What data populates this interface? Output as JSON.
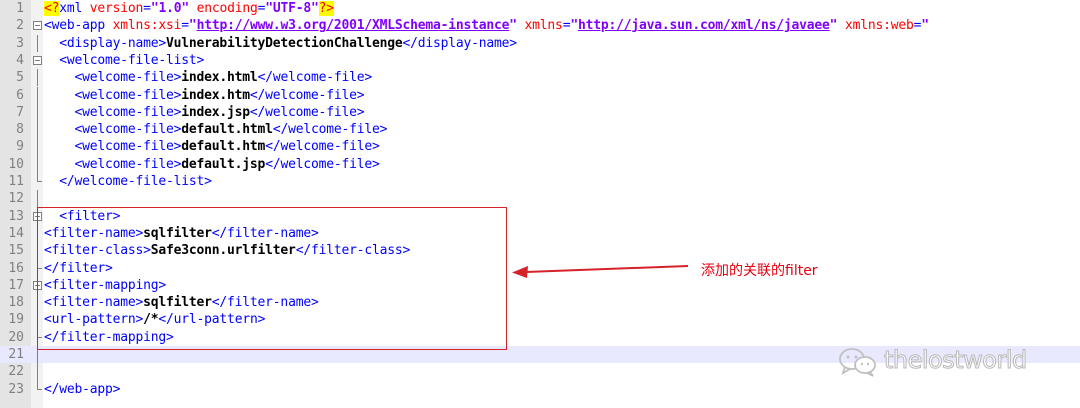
{
  "editor": {
    "lines": [
      {
        "n": "1",
        "fold": "none",
        "parts": [
          [
            "pi",
            "<?"
          ],
          [
            "tag",
            "xml "
          ],
          [
            "attr",
            "version"
          ],
          [
            "tag",
            "="
          ],
          [
            "val",
            "\"1.0\""
          ],
          [
            "tag",
            " "
          ],
          [
            "attr",
            "encoding"
          ],
          [
            "tag",
            "="
          ],
          [
            "val",
            "\"UTF-8\""
          ],
          [
            "pi",
            "?>"
          ]
        ]
      },
      {
        "n": "2",
        "fold": "box",
        "parts": [
          [
            "tag",
            "<web-app "
          ],
          [
            "attr",
            "xmlns:xsi"
          ],
          [
            "tag",
            "="
          ],
          [
            "val",
            "\""
          ],
          [
            "url",
            "http://www.w3.org/2001/XMLSchema-instance"
          ],
          [
            "val",
            "\""
          ],
          [
            "tag",
            " "
          ],
          [
            "attr",
            "xmlns"
          ],
          [
            "tag",
            "="
          ],
          [
            "val",
            "\""
          ],
          [
            "url",
            "http://java.sun.com/xml/ns/javaee"
          ],
          [
            "val",
            "\""
          ],
          [
            "tag",
            " "
          ],
          [
            "attr",
            "xmlns:web"
          ],
          [
            "tag",
            "="
          ],
          [
            "val",
            "\""
          ]
        ]
      },
      {
        "n": "3",
        "fold": "vline",
        "parts": [
          [
            "tag",
            "  <display-name>"
          ],
          [
            "txt",
            "VulnerabilityDetectionChallenge"
          ],
          [
            "tag",
            "</display-name>"
          ]
        ]
      },
      {
        "n": "4",
        "fold": "box",
        "parts": [
          [
            "tag",
            "  <welcome-file-list>"
          ]
        ]
      },
      {
        "n": "5",
        "fold": "vline",
        "parts": [
          [
            "tag",
            "    <welcome-file>"
          ],
          [
            "txt",
            "index.html"
          ],
          [
            "tag",
            "</welcome-file>"
          ]
        ]
      },
      {
        "n": "6",
        "fold": "vline",
        "parts": [
          [
            "tag",
            "    <welcome-file>"
          ],
          [
            "txt",
            "index.htm"
          ],
          [
            "tag",
            "</welcome-file>"
          ]
        ]
      },
      {
        "n": "7",
        "fold": "vline",
        "parts": [
          [
            "tag",
            "    <welcome-file>"
          ],
          [
            "txt",
            "index.jsp"
          ],
          [
            "tag",
            "</welcome-file>"
          ]
        ]
      },
      {
        "n": "8",
        "fold": "vline",
        "parts": [
          [
            "tag",
            "    <welcome-file>"
          ],
          [
            "txt",
            "default.html"
          ],
          [
            "tag",
            "</welcome-file>"
          ]
        ]
      },
      {
        "n": "9",
        "fold": "vline",
        "parts": [
          [
            "tag",
            "    <welcome-file>"
          ],
          [
            "txt",
            "default.htm"
          ],
          [
            "tag",
            "</welcome-file>"
          ]
        ]
      },
      {
        "n": "10",
        "fold": "vline",
        "parts": [
          [
            "tag",
            "    <welcome-file>"
          ],
          [
            "txt",
            "default.jsp"
          ],
          [
            "tag",
            "</welcome-file>"
          ]
        ]
      },
      {
        "n": "11",
        "fold": "end",
        "parts": [
          [
            "tag",
            "  </welcome-file-list>"
          ]
        ]
      },
      {
        "n": "12",
        "fold": "vline",
        "parts": []
      },
      {
        "n": "13",
        "fold": "box",
        "parts": [
          [
            "tag",
            "  <filter>"
          ]
        ]
      },
      {
        "n": "14",
        "fold": "vline",
        "parts": [
          [
            "tag",
            "<filter-name>"
          ],
          [
            "txt",
            "sqlfilter"
          ],
          [
            "tag",
            "</filter-name>"
          ]
        ]
      },
      {
        "n": "15",
        "fold": "vline",
        "parts": [
          [
            "tag",
            "<filter-class>"
          ],
          [
            "txt",
            "Safe3conn.urlfilter"
          ],
          [
            "tag",
            "</filter-class>"
          ]
        ]
      },
      {
        "n": "16",
        "fold": "end",
        "parts": [
          [
            "tag",
            "</filter>"
          ]
        ]
      },
      {
        "n": "17",
        "fold": "box",
        "parts": [
          [
            "tag",
            "<filter-mapping>"
          ]
        ]
      },
      {
        "n": "18",
        "fold": "vline",
        "parts": [
          [
            "tag",
            "<filter-name>"
          ],
          [
            "txt",
            "sqlfilter"
          ],
          [
            "tag",
            "</filter-name>"
          ]
        ]
      },
      {
        "n": "19",
        "fold": "vline",
        "parts": [
          [
            "tag",
            "<url-pattern>"
          ],
          [
            "txt",
            "/*"
          ],
          [
            "tag",
            "</url-pattern>"
          ]
        ]
      },
      {
        "n": "20",
        "fold": "end",
        "parts": [
          [
            "tag",
            "</filter-mapping>"
          ]
        ]
      },
      {
        "n": "21",
        "fold": "vline",
        "parts": [],
        "current": true
      },
      {
        "n": "22",
        "fold": "vline",
        "parts": []
      },
      {
        "n": "23",
        "fold": "end",
        "parts": [
          [
            "tag",
            "</web-app>"
          ]
        ]
      }
    ]
  },
  "annotation": {
    "note": "添加的关联的filter",
    "color": "#e60012"
  },
  "watermark": {
    "text": "thelostworld",
    "icon": "wechat-icon"
  },
  "colors": {
    "tag": "#0000ff",
    "attribute": "#ff0000",
    "value": "#8000ff",
    "text": "#000000",
    "gutter": "#e4e4e4",
    "current_line": "#e8e8ff"
  }
}
